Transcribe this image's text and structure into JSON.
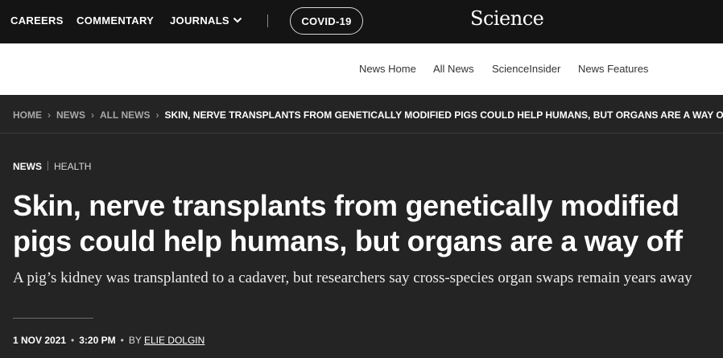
{
  "topnav": {
    "careers": "CAREERS",
    "commentary": "COMMENTARY",
    "journals": "JOURNALS",
    "covid": "COVID-19",
    "logo": "Science"
  },
  "subnav": {
    "items": [
      "News Home",
      "All News",
      "ScienceInsider",
      "News Features"
    ]
  },
  "breadcrumb": {
    "items": [
      "HOME",
      "NEWS",
      "ALL NEWS"
    ],
    "current": "SKIN, NERVE TRANSPLANTS FROM GENETICALLY MODIFIED PIGS COULD HELP HUMANS, BUT ORGANS ARE A WAY OFF",
    "separator": "›"
  },
  "article": {
    "section": "NEWS",
    "topic": "HEALTH",
    "headline": "Skin, nerve transplants from genetically modified pigs could help humans, but organs are a way off",
    "dek": "A pig’s kidney was transplanted to a cadaver, but researchers say cross-species organ swaps remain years away",
    "date": "1 NOV 2021",
    "time": "3:20 PM",
    "by_prefix": "BY",
    "author": "ELIE DOLGIN",
    "separator": "•"
  },
  "colors": {
    "top_bar": "#141414",
    "page_background": "#242424",
    "subnav_background": "#ffffff"
  },
  "icons": {
    "journals_dropdown": "chevron-down-icon"
  }
}
